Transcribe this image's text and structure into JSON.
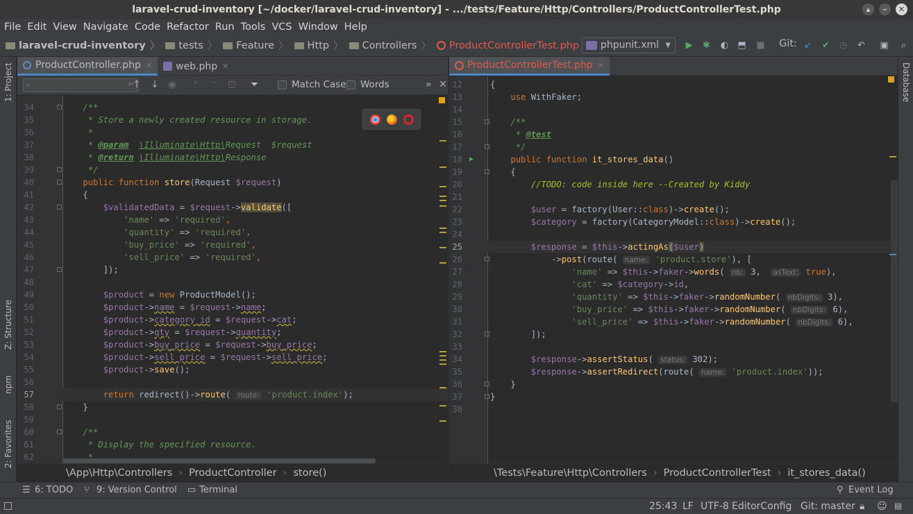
{
  "window": {
    "title": "laravel-crud-inventory [~/docker/laravel-crud-inventory] - .../tests/Feature/Http/Controllers/ProductControllerTest.php",
    "buttons": [
      "▴",
      "–",
      "✕"
    ]
  },
  "menu": [
    "File",
    "Edit",
    "View",
    "Navigate",
    "Code",
    "Refactor",
    "Run",
    "Tools",
    "VCS",
    "Window",
    "Help"
  ],
  "navbar": {
    "crumbs": [
      "laravel-crud-inventory",
      "tests",
      "Feature",
      "Http",
      "Controllers",
      "ProductControllerTest.php"
    ],
    "run_config": "phpunit.xml",
    "git_label": "Git:"
  },
  "left_strip": {
    "project": "1: Project",
    "structure": "Z: Structure",
    "npm": "npm",
    "favorites": "2: Favorites"
  },
  "right_strip": {
    "database": "Database"
  },
  "left_pane": {
    "tabs": [
      {
        "label": "ProductController.php"
      },
      {
        "label": "web.php"
      }
    ],
    "find": {
      "match_case": "Match Case",
      "words": "Words"
    },
    "breadcrumb": [
      "\\App\\Http\\Controllers",
      "ProductController",
      "store()"
    ],
    "lines": [
      {
        "n": "34",
        "t": "    /**"
      },
      {
        "n": "35",
        "t": "     * Store a newly created resource in storage."
      },
      {
        "n": "36",
        "t": "     *"
      },
      {
        "n": "37",
        "t": "     * @param  \\Illuminate\\Http\\Request  $request"
      },
      {
        "n": "38",
        "t": "     * @return \\Illuminate\\Http\\Response"
      },
      {
        "n": "39",
        "t": "     */"
      },
      {
        "n": "40",
        "t": "    public function store(Request $request)"
      },
      {
        "n": "41",
        "t": "    {"
      },
      {
        "n": "42",
        "t": "        $validatedData = $request->validate(["
      },
      {
        "n": "43",
        "t": "            'name' => 'required',"
      },
      {
        "n": "44",
        "t": "            'quantity' => 'required',"
      },
      {
        "n": "45",
        "t": "            'buy_price' => 'required',"
      },
      {
        "n": "46",
        "t": "            'sell_price' => 'required',"
      },
      {
        "n": "47",
        "t": "        ]);"
      },
      {
        "n": "48",
        "t": ""
      },
      {
        "n": "49",
        "t": "        $product = new ProductModel();"
      },
      {
        "n": "50",
        "t": "        $product->name = $request->name;"
      },
      {
        "n": "51",
        "t": "        $product->category_id = $request->cat;"
      },
      {
        "n": "52",
        "t": "        $product->qty = $request->quantity;"
      },
      {
        "n": "53",
        "t": "        $product->buy_price = $request->buy_price;"
      },
      {
        "n": "54",
        "t": "        $product->sell_price = $request->sell_price;"
      },
      {
        "n": "55",
        "t": "        $product->save();"
      },
      {
        "n": "56",
        "t": ""
      },
      {
        "n": "57",
        "t": "        return redirect()->route( route: 'product.index');"
      },
      {
        "n": "58",
        "t": "    }"
      },
      {
        "n": "59",
        "t": ""
      },
      {
        "n": "60",
        "t": "    /**"
      },
      {
        "n": "61",
        "t": "     * Display the specified resource."
      },
      {
        "n": "62",
        "t": "     *"
      }
    ]
  },
  "right_pane": {
    "tabs": [
      {
        "label": "ProductControllerTest.php"
      }
    ],
    "breadcrumb": [
      "\\Tests\\Feature\\Http\\Controllers",
      "ProductControllerTest",
      "it_stores_data()"
    ],
    "lines": [
      {
        "n": "12",
        "t": "{"
      },
      {
        "n": "13",
        "t": "    use WithFaker;"
      },
      {
        "n": "14",
        "t": ""
      },
      {
        "n": "15",
        "t": "    /**"
      },
      {
        "n": "16",
        "t": "     * @test"
      },
      {
        "n": "17",
        "t": "     */"
      },
      {
        "n": "18",
        "t": "    public function it_stores_data()"
      },
      {
        "n": "19",
        "t": "    {"
      },
      {
        "n": "20",
        "t": "        //TODO: code inside here --Created by Kiddy"
      },
      {
        "n": "21",
        "t": ""
      },
      {
        "n": "22",
        "t": "        $user = factory(User::class)->create();"
      },
      {
        "n": "23",
        "t": "        $category = factory(CategoryModel::class)->create();"
      },
      {
        "n": "24",
        "t": ""
      },
      {
        "n": "25",
        "t": "        $response = $this->actingAs($user)"
      },
      {
        "n": "26",
        "t": "            ->post(route( name: 'product.store'), ["
      },
      {
        "n": "27",
        "t": "                'name' => $this->faker->words( nb: 3,  asText: true),"
      },
      {
        "n": "28",
        "t": "                'cat' => $category->id,"
      },
      {
        "n": "29",
        "t": "                'quantity' => $this->faker->randomNumber( nbDigits: 3),"
      },
      {
        "n": "30",
        "t": "                'buy_price' => $this->faker->randomNumber( nbDigits: 6),"
      },
      {
        "n": "31",
        "t": "                'sell_price' => $this->faker->randomNumber( nbDigits: 6),"
      },
      {
        "n": "32",
        "t": "        ]);"
      },
      {
        "n": "33",
        "t": ""
      },
      {
        "n": "34",
        "t": "        $response->assertStatus( status: 302);"
      },
      {
        "n": "35",
        "t": "        $response->assertRedirect(route( name: 'product.index'));"
      },
      {
        "n": "36",
        "t": "    }"
      },
      {
        "n": "37",
        "t": "}"
      },
      {
        "n": "38",
        "t": ""
      }
    ]
  },
  "tool_windows": {
    "todo": "6: TODO",
    "vcs": "9: Version Control",
    "terminal": "Terminal",
    "event_log": "Event Log"
  },
  "status": {
    "position": "25:43",
    "line_sep": "LF",
    "encoding": "UTF-8",
    "editorconfig": "EditorConfig",
    "git": "Git: master"
  }
}
